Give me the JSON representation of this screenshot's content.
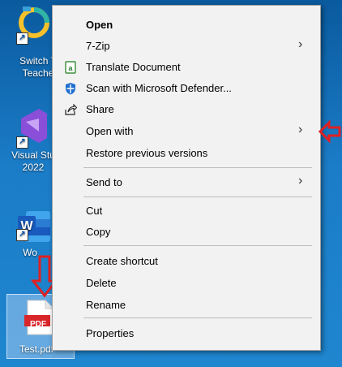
{
  "desktop": {
    "icons": [
      {
        "label": "Switch T\nTeache"
      },
      {
        "label": "Visual Stu\n2022"
      },
      {
        "label": "Wo"
      },
      {
        "label": "Test.pdf"
      }
    ],
    "pdf_badge": "PDF"
  },
  "menu": {
    "open": "Open",
    "zip": "7-Zip",
    "translate": "Translate Document",
    "scan": "Scan with Microsoft Defender...",
    "share": "Share",
    "open_with": "Open with",
    "restore": "Restore previous versions",
    "send_to": "Send to",
    "cut": "Cut",
    "copy": "Copy",
    "create_shortcut": "Create shortcut",
    "delete": "Delete",
    "rename": "Rename",
    "properties": "Properties",
    "submenu_glyph": "›"
  },
  "colors": {
    "annotation_arrow": "#e02020",
    "menu_bg": "#f2f2f2",
    "desktop_bg": "#1b7cc7"
  }
}
